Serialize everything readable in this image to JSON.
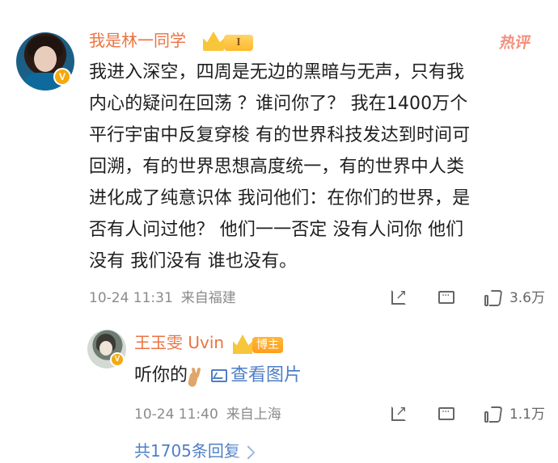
{
  "main_comment": {
    "username": "我是林一同学",
    "member_level": "I",
    "hot_label": "热评",
    "text": "我进入深空，四周是无边的黑暗与无声，只有我\n内心的疑问在回荡 ？谁问你了？ 我在1400万个\n平行宇宙中反复穿梭 有的世界科技发达到时间可\n回溯，有的世界思想高度统一，有的世界中人类\n进化成了纯意识体 我问他们：在你们的世界，是\n否有人问过他？ 他们一一否定 没有人问你 他们\n没有 我们没有 谁也没有。",
    "timestamp": "10-24 11:31",
    "location": "来自福建",
    "like_count": "3.6万",
    "verified_mark": "V"
  },
  "reply": {
    "username": "王玉雯 Uvin",
    "badge_label": "博主",
    "text": "听你的",
    "image_link_text": "查看图片",
    "timestamp": "10-24 11:40",
    "location": "来自上海",
    "like_count": "1.1万",
    "verified_mark": "V"
  },
  "thread": {
    "total_replies": "共1705条回复"
  },
  "icons": {
    "share": "share-icon",
    "comment": "comment-icon",
    "like": "like-icon",
    "image": "image-icon",
    "peace": "peace-hand-icon",
    "chevron": "chevron-right-icon"
  },
  "colors": {
    "username": "#eb7341",
    "hot_label": "#f3907d",
    "link_blue": "#4f7fc6",
    "meta_gray": "#8b8b8b",
    "badge_gold": "#f7c63a",
    "badge_orange": "#ffa31f"
  }
}
